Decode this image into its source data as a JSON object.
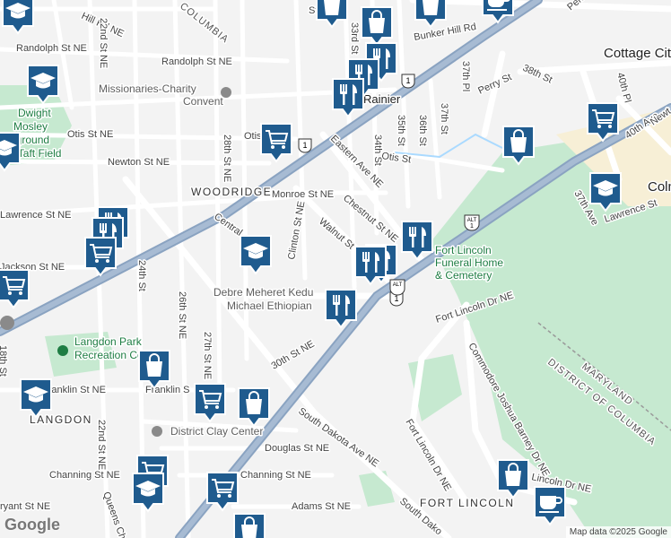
{
  "map": {
    "colors": {
      "background": "#f3f3f3",
      "road": "#ffffff",
      "highway": "#8aa3c1",
      "park": "#c6e9d0",
      "water": "#aadaff",
      "pin": "#1f5b8e"
    },
    "neighborhoods": [
      "WOODRIDGE",
      "LANGDON",
      "FORT LINCOLN"
    ],
    "cities": [
      "Cottage City",
      "Colm"
    ],
    "rainier": "Rainier",
    "streets": [
      "Hill Rd NE",
      "Randolph St NE",
      "Randolph St NE",
      "22nd St NE",
      "24th St NE",
      "Otis St NE",
      "Otis",
      "Newton St NE",
      "Monroe St NE",
      "Lawrence St NE",
      "Central",
      "Clinton St NE",
      "Walnut St",
      "Chestnut St NE",
      "Eastern Ave NE",
      "Otis St",
      "Bunker Hill Rd",
      "38th St",
      "37th Pl",
      "Perry St",
      "40th Pl",
      "40th Ave",
      "37th Ave",
      "Lawrence St",
      "Newt",
      "34th St",
      "35th St",
      "36th St",
      "37th St",
      "33rd St",
      "Fort Lincoln Dr NE",
      "Fort Lincoln Dr NE",
      "Commodore Joshua Barney Dr NE",
      "Lincoln Dr NE",
      "30th St NE",
      "South Dakota Ave NE",
      "South Dako",
      "Franklin St NE",
      "Franklin S",
      "Douglas St NE",
      "Channing St NE",
      "Channing St NE",
      "Adams St NE",
      "Queens Ch",
      "22nd St NE",
      "26th St NE",
      "27th St NE",
      "28th St NE",
      "24th St",
      "Jackson St NE",
      "18th St",
      "ryant St NE",
      "Perr",
      "St"
    ],
    "route_shields": [
      "1",
      "1",
      "1",
      "ALT 1",
      "ALT 1",
      "ALT"
    ],
    "pois": [
      "Missionaries-Charity Convent",
      "Dwight Mosley Playground and Taft Field",
      "Debre Meheret Kedus Michael Ethiopian",
      "Langdon Park Recreation Center",
      "District Clay Center",
      "Fort Lincoln Funeral Home & Cemetery",
      "COLUMBIA"
    ],
    "boundary_label": [
      "MARYLAND",
      "DISTRICT OF COLUMBIA"
    ],
    "markers": [
      {
        "type": "restaurant",
        "icon": "utensils-icon"
      },
      {
        "type": "grocery",
        "icon": "shopping-cart-icon"
      },
      {
        "type": "shopping",
        "icon": "shopping-bag-icon"
      },
      {
        "type": "school",
        "icon": "graduation-cap-icon"
      },
      {
        "type": "cafe",
        "icon": "coffee-cup-icon"
      }
    ]
  },
  "google_logo": "Google",
  "attribution": "Map data ©2025 Google"
}
